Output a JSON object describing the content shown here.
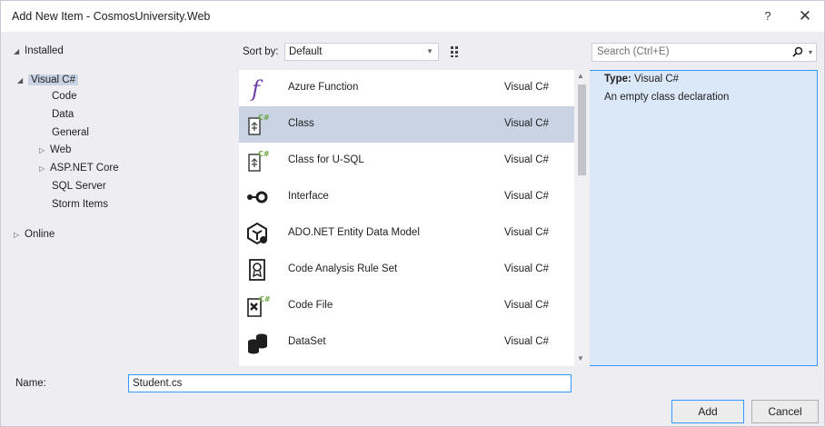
{
  "window": {
    "title": "Add New Item - CosmosUniversity.Web",
    "help": "?",
    "close": "✕"
  },
  "tree": {
    "installed": "Installed",
    "visual_csharp": "Visual C#",
    "code": "Code",
    "data": "Data",
    "general": "General",
    "web": "Web",
    "aspnet_core": "ASP.NET Core",
    "sql_server": "SQL Server",
    "storm_items": "Storm Items",
    "online": "Online"
  },
  "toolbar": {
    "sort_label": "Sort by:",
    "sort_value": "Default"
  },
  "search": {
    "placeholder": "Search (Ctrl+E)"
  },
  "templates": [
    {
      "name": "Azure Function",
      "lang": "Visual C#",
      "icon": "azure-function-icon"
    },
    {
      "name": "Class",
      "lang": "Visual C#",
      "icon": "class-icon"
    },
    {
      "name": "Class for U-SQL",
      "lang": "Visual C#",
      "icon": "class-usql-icon"
    },
    {
      "name": "Interface",
      "lang": "Visual C#",
      "icon": "interface-icon"
    },
    {
      "name": "ADO.NET Entity Data Model",
      "lang": "Visual C#",
      "icon": "entity-model-icon"
    },
    {
      "name": "Code Analysis Rule Set",
      "lang": "Visual C#",
      "icon": "rule-set-icon"
    },
    {
      "name": "Code File",
      "lang": "Visual C#",
      "icon": "code-file-icon"
    },
    {
      "name": "DataSet",
      "lang": "Visual C#",
      "icon": "dataset-icon"
    }
  ],
  "selected_index": 1,
  "details": {
    "type_label": "Type:",
    "type_value": "Visual C#",
    "description": "An empty class declaration"
  },
  "name_field": {
    "label": "Name:",
    "value": "Student.cs"
  },
  "buttons": {
    "add": "Add",
    "cancel": "Cancel"
  },
  "colors": {
    "accent": "#3399ff",
    "selection": "#c9d3e3",
    "csharp_green": "#68a63c",
    "function_purple": "#6c3ca8"
  }
}
